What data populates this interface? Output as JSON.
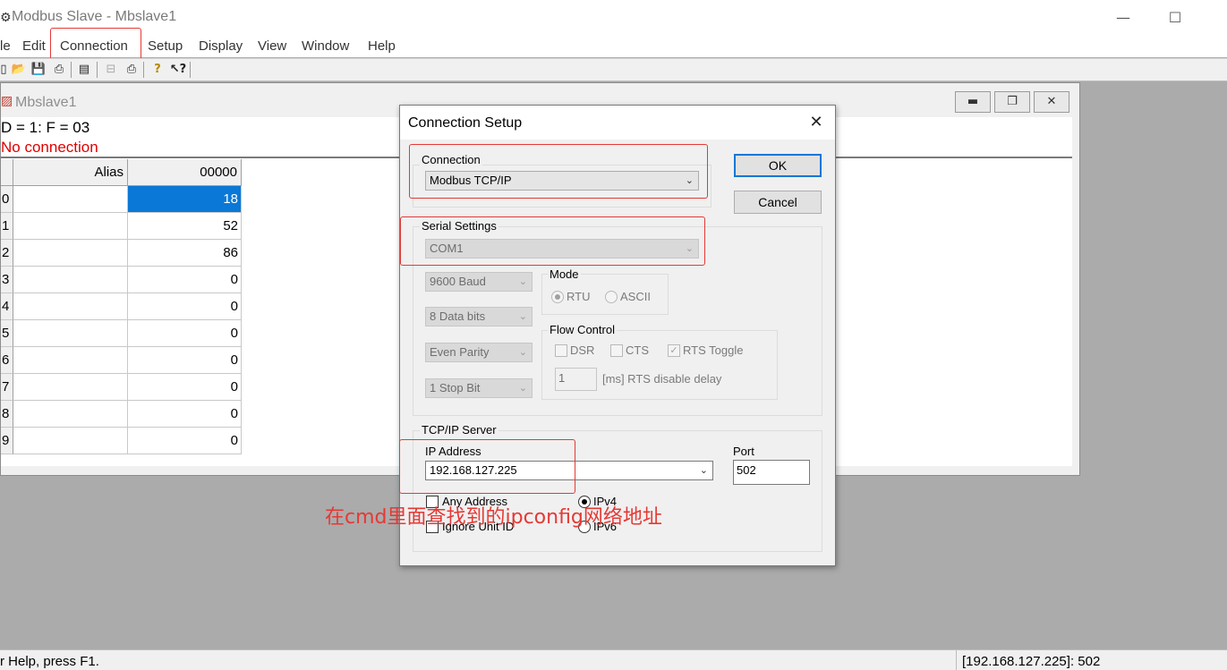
{
  "window": {
    "title": "Modbus Slave - Mbslave1",
    "icon": "modbus-app-icon",
    "controls": {
      "minimize": "—",
      "maximize": "☐"
    }
  },
  "menu": {
    "items": [
      "le",
      "Edit",
      "Connection",
      "Setup",
      "Display",
      "View",
      "Window",
      "Help"
    ],
    "highlighted": "Connection"
  },
  "toolbar": {
    "icons": [
      "new-icon",
      "open-icon",
      "save-icon",
      "print-icon",
      "window-icon",
      "connect-icon",
      "disconnect-icon",
      "help-icon",
      "context-help-icon"
    ]
  },
  "child_window": {
    "title": "Mbslave1",
    "info_line": "D = 1: F = 03",
    "status_line": "No connection",
    "status_color": "#e00000",
    "table": {
      "columns": [
        "Alias",
        "00000"
      ],
      "rows": [
        {
          "num": "0",
          "alias": "",
          "value": "18",
          "selected": true
        },
        {
          "num": "1",
          "alias": "",
          "value": "52"
        },
        {
          "num": "2",
          "alias": "",
          "value": "86"
        },
        {
          "num": "3",
          "alias": "",
          "value": "0"
        },
        {
          "num": "4",
          "alias": "",
          "value": "0"
        },
        {
          "num": "5",
          "alias": "",
          "value": "0"
        },
        {
          "num": "6",
          "alias": "",
          "value": "0"
        },
        {
          "num": "7",
          "alias": "",
          "value": "0"
        },
        {
          "num": "8",
          "alias": "",
          "value": "0"
        },
        {
          "num": "9",
          "alias": "",
          "value": "0"
        }
      ]
    }
  },
  "dialog": {
    "title": "Connection Setup",
    "ok_label": "OK",
    "cancel_label": "Cancel",
    "connection": {
      "label": "Connection",
      "value": "Modbus TCP/IP"
    },
    "serial": {
      "label": "Serial Settings",
      "port": "COM1",
      "baud": "9600 Baud",
      "data_bits": "8 Data bits",
      "parity": "Even Parity",
      "stop_bits": "1 Stop Bit",
      "mode": {
        "label": "Mode",
        "rtu": "RTU",
        "ascii": "ASCII"
      },
      "flow": {
        "label": "Flow Control",
        "dsr": "DSR",
        "cts": "CTS",
        "rts_toggle": "RTS Toggle",
        "delay_value": "1",
        "delay_label": "[ms] RTS disable delay"
      }
    },
    "tcp": {
      "label": "TCP/IP Server",
      "ip_label": "IP Address",
      "ip_value": "192.168.127.225",
      "port_label": "Port",
      "port_value": "502",
      "any_address": "Any Address",
      "ignore_unit_id": "Ignore Unit ID",
      "ipv4": "IPv4",
      "ipv6": "IPv6"
    }
  },
  "annotation": "在cmd里面查找到的ipconfig网络地址",
  "statusbar": {
    "left": "r Help, press F1.",
    "right": "[192.168.127.225]: 502"
  },
  "colors": {
    "highlight_box": "#e53935",
    "selection": "#0a78d7"
  }
}
